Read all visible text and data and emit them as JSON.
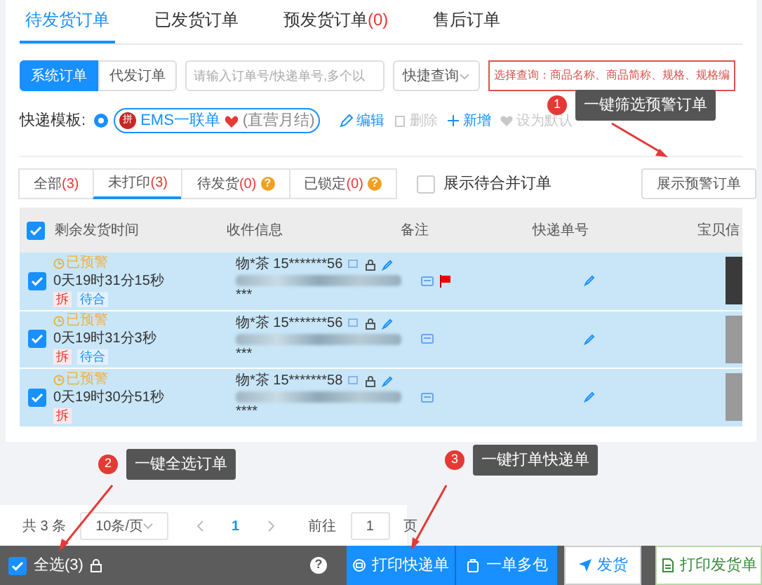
{
  "tabs": [
    {
      "label": "待发货订单",
      "selected": true
    },
    {
      "label": "已发货订单",
      "selected": false
    },
    {
      "label": "预发货订单",
      "count": "(0)",
      "selected": false
    },
    {
      "label": "售后订单",
      "selected": false
    }
  ],
  "order_type": [
    {
      "label": "系统订单",
      "selected": true
    },
    {
      "label": "代发订单",
      "selected": false
    }
  ],
  "search": {
    "placeholder": "请输入订单号/快递单号,多个以"
  },
  "quick_query": {
    "label": "快捷查询"
  },
  "select_query": "选择查询：商品名称、商品简称、规格、规格编",
  "template": {
    "label": "快递模板:",
    "selected": true,
    "badge": "拼",
    "name": "EMS一联单",
    "note": "(直营月结)",
    "actions": [
      {
        "label": "编辑",
        "disabled": false
      },
      {
        "label": "删除",
        "disabled": true
      },
      {
        "label": "新增",
        "disabled": false
      },
      {
        "label": "设为默认",
        "disabled": true
      }
    ]
  },
  "filters": [
    {
      "label": "全部",
      "count": "(3)",
      "selected": false
    },
    {
      "label": "未打印",
      "count": "(3)",
      "selected": true
    },
    {
      "label": "待发货",
      "count": "(0)",
      "help": "?",
      "selected": false
    },
    {
      "label": "已锁定",
      "count": "(0)",
      "help": "?",
      "selected": false
    }
  ],
  "merge_option": {
    "label": "展示待合并订单",
    "checked": false
  },
  "warning_button": "展示预警订单",
  "table": {
    "all_checked": true,
    "columns": [
      "剩余发货时间",
      "收件信息",
      "备注",
      "快递单号",
      "宝贝信"
    ],
    "rows": [
      {
        "checked": true,
        "warning": "已预警",
        "time": "0天19时31分15秒",
        "tags": [
          "拆",
          "待合"
        ],
        "recipient": "物*茶 15*******56",
        "extra": "***",
        "flagged": true
      },
      {
        "checked": true,
        "warning": "已预警",
        "time": "0天19时31分3秒",
        "tags": [
          "拆",
          "待合"
        ],
        "recipient": "物*茶 15*******56",
        "extra": "***",
        "flagged": false
      },
      {
        "checked": true,
        "warning": "已预警",
        "time": "0天19时30分51秒",
        "tags": [
          "拆"
        ],
        "recipient": "物*茶 15*******58",
        "extra": "****",
        "flagged": false
      }
    ]
  },
  "pagination": {
    "total": "共 3 条",
    "page_size": "10条/页",
    "page": "1",
    "goto_label": "前往",
    "goto_value": "1",
    "unit": "页"
  },
  "bottom_bar": {
    "select_all": {
      "label": "全选(3)",
      "checked": true
    },
    "help": "?",
    "buttons": [
      "打印快递单",
      "一单多包",
      "发货",
      "打印发货单"
    ]
  },
  "annotations": [
    {
      "number": "1",
      "text": "一键筛选预警订单"
    },
    {
      "number": "2",
      "text": "一键全选订单"
    },
    {
      "number": "3",
      "text": "一键打单快递单"
    }
  ]
}
